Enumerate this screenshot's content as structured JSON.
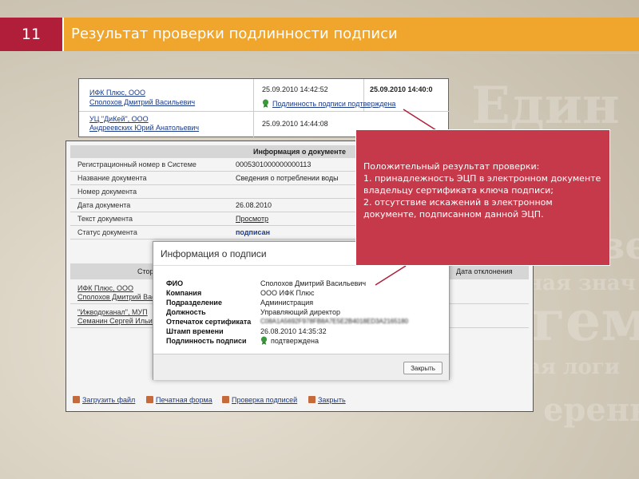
{
  "slide": {
    "number": "11",
    "title": "Результат проверки подлинности подписи"
  },
  "background_words": [
    "Един",
    "стве",
    "ная знач",
    "гем",
    "ая логи",
    "еренна"
  ],
  "signatures_top": {
    "rows": [
      {
        "org": "ИФК Плюс, ООО",
        "person": "Сполохов Дмитрий Васильевич",
        "date": "25.09.2010 14:42:52",
        "date2": "25.09.2010 14:40:0",
        "status": "Подлинность подписи подтверждена"
      },
      {
        "org": "УЦ \"ДиКей\", ООО",
        "person": "Андреевских Юрий Анатольевич",
        "date": "25.09.2010 14:44:08"
      }
    ]
  },
  "document_info": {
    "header": "Информация о документе",
    "rows": [
      {
        "label": "Регистрационный номер в Системе",
        "value": "0005301000000000113"
      },
      {
        "label": "Название документа",
        "value": "Сведения о потреблении воды"
      },
      {
        "label": "Номер документа",
        "value": ""
      },
      {
        "label": "Дата документа",
        "value": "26.08.2010"
      },
      {
        "label": "Текст документа",
        "value": "Просмотр"
      },
      {
        "label": "Статус документа",
        "value": "подписан"
      }
    ],
    "sides_header_left": "Сторо",
    "sides_header_right": "Дата отклонения",
    "sides": [
      {
        "org": "ИФК Плюс, ООО",
        "person": "Сполохов Дмитрий Вас"
      },
      {
        "org": "\"Ижводоканал\", МУП",
        "person": "Семанин Сергей Ильич"
      }
    ],
    "bottom_links": [
      "Загрузить файл",
      "Печатная форма",
      "Проверка подписей",
      "Закрыть"
    ]
  },
  "signature_modal": {
    "title": "Информация о подписи",
    "rows": [
      {
        "label": "ФИО",
        "value": "Сполохов Дмитрий Васильевич"
      },
      {
        "label": "Компания",
        "value": "ООО ИФК Плюс"
      },
      {
        "label": "Подразделение",
        "value": "Администрация"
      },
      {
        "label": "Должность",
        "value": "Управляющий директор"
      },
      {
        "label": "Отпечаток сертификата",
        "value": "C08A1A5692F978FB8A7E5E2B4018ED3A2165180"
      },
      {
        "label": "Штамп времени",
        "value": "26.08.2010 14:35:32"
      },
      {
        "label": "Подлинность подписи",
        "value": "подтверждена"
      }
    ],
    "close_label": "Закрыть"
  },
  "callout": {
    "lines": [
      "Положительный результат проверки:",
      "1. принадлежность ЭЦП в электронном документе владельцу сертификата ключа подписи;",
      "2. отсутствие искажений в электронном документе, подписанном данной ЭЦП."
    ]
  },
  "colors": {
    "accent_red": "#b01e3a",
    "accent_orange": "#f0a52c",
    "callout": "#c6394a",
    "link": "#1a3a8a"
  }
}
